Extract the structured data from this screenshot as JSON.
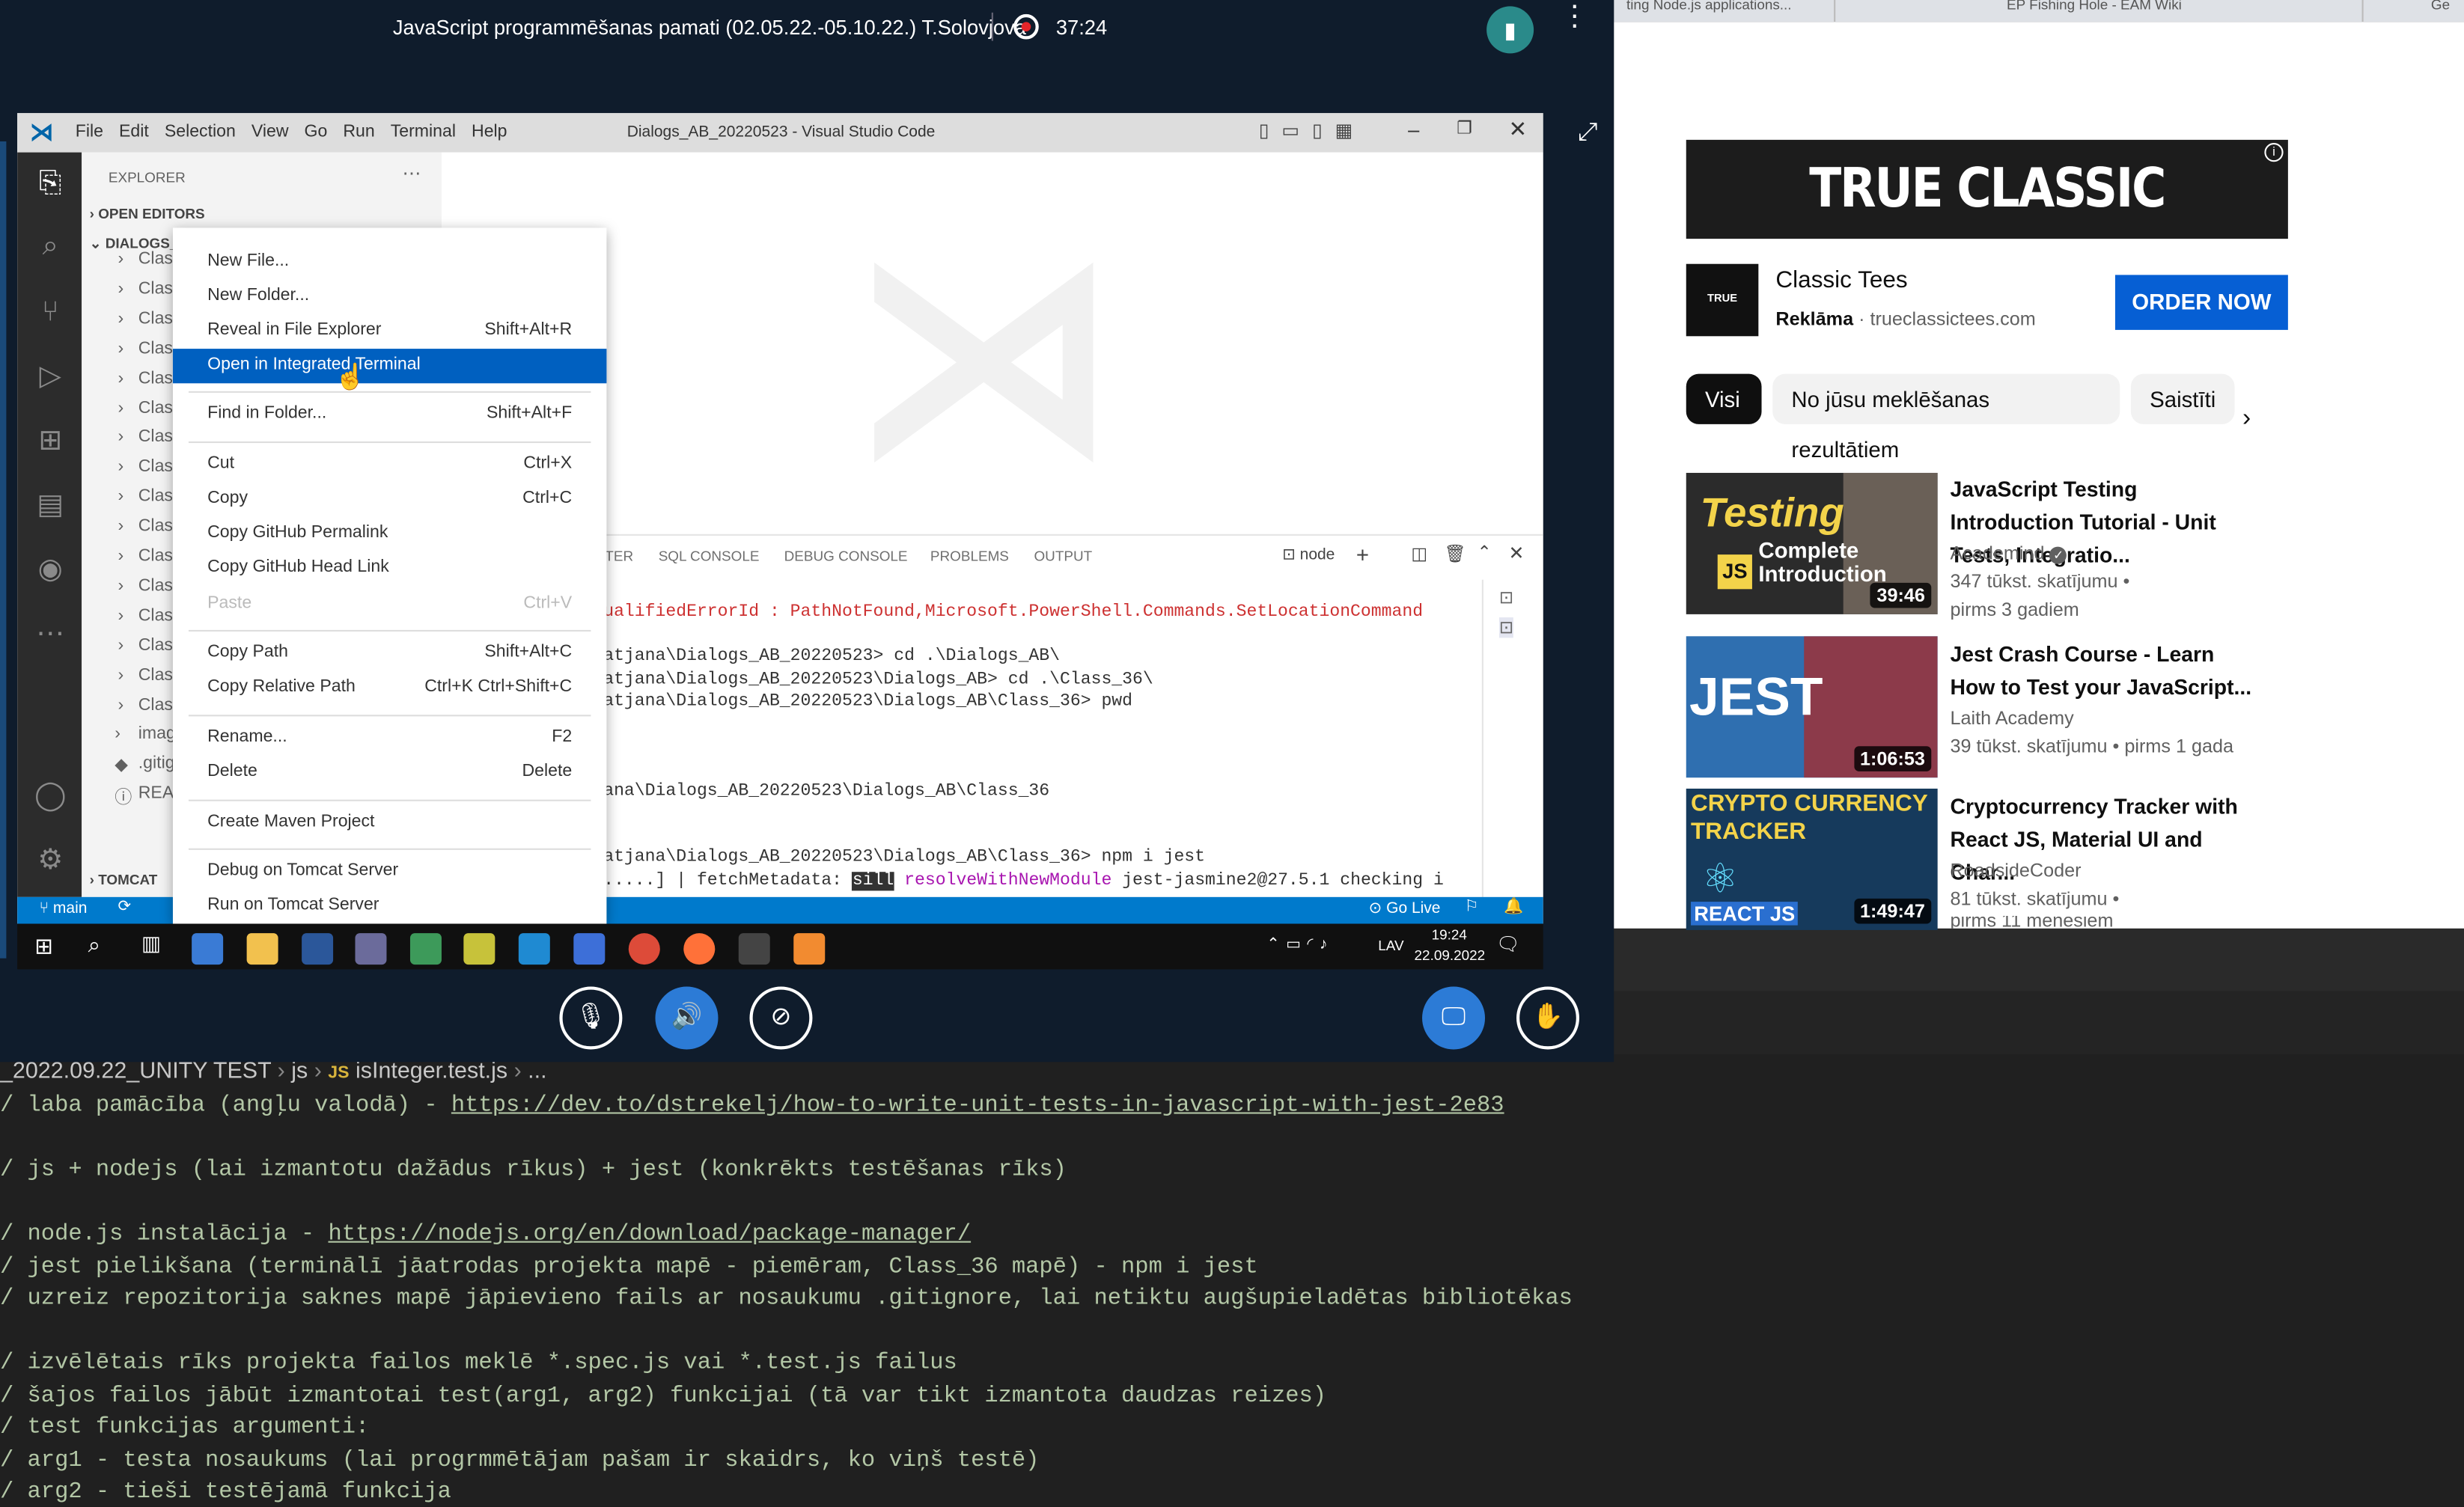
{
  "meeting": {
    "title": "JavaScript programmēšanas pamati (02.05.22.-05.10.22.) T.Solovjova",
    "rec_time": "37:24"
  },
  "vscode": {
    "menu": [
      "File",
      "Edit",
      "Selection",
      "View",
      "Go",
      "Run",
      "Terminal",
      "Help"
    ],
    "window_title": "Dialogs_AB_20220523 - Visual Studio Code",
    "explorer_header": "EXPLORER",
    "open_editors": "OPEN EDITORS",
    "dialogs_folder": "DIALOGS_AB_20220523",
    "tree_items": [
      "Class",
      "Class",
      "Class",
      "Class",
      "Class",
      "Class",
      "Class",
      "Class",
      "Class",
      "Class",
      "Class",
      "Class",
      "Class",
      "Class",
      "Class",
      "Class"
    ],
    "imag": "imag",
    "gitig": ".gitig",
    "readme": "READ",
    "tomcat": "TOMCAT",
    "panel_tabs": [
      "TER",
      "SQL CONSOLE",
      "DEBUG CONSOLE",
      "PROBLEMS",
      "OUTPUT"
    ],
    "terminal_name": "node",
    "terminal_lines": [
      "ualifiedErrorId : PathNotFound,Microsoft.PowerShell.Commands.SetLocationCommand",
      "",
      "atjana\\Dialogs_AB_20220523> cd .\\Dialogs_AB\\",
      "atjana\\Dialogs_AB_20220523\\Dialogs_AB> cd .\\Class_36\\",
      "atjana\\Dialogs_AB_20220523\\Dialogs_AB\\Class_36> pwd",
      "",
      "",
      "",
      "ana\\Dialogs_AB_20220523\\Dialogs_AB\\Class_36",
      "",
      "",
      "atjana\\Dialogs_AB_20220523\\Dialogs_AB\\Class_36> npm i jest"
    ],
    "last_line_a": ".....] | fetchMetadata: ",
    "last_line_sill": "sill",
    "last_line_b": " resolveWithNewModule",
    "last_line_c": " jest-jasmine2@27.5.1 checking i",
    "status_branch": "main",
    "status_golive": "Go Live",
    "context_menu": [
      {
        "label": "New File...",
        "key": ""
      },
      {
        "label": "New Folder...",
        "key": ""
      },
      {
        "label": "Reveal in File Explorer",
        "key": "Shift+Alt+R"
      },
      {
        "label": "Open in Integrated Terminal",
        "key": ""
      },
      {
        "label": "Find in Folder...",
        "key": "Shift+Alt+F"
      },
      {
        "label": "Cut",
        "key": "Ctrl+X"
      },
      {
        "label": "Copy",
        "key": "Ctrl+C"
      },
      {
        "label": "Copy GitHub Permalink",
        "key": ""
      },
      {
        "label": "Copy GitHub Head Link",
        "key": ""
      },
      {
        "label": "Paste",
        "key": "Ctrl+V"
      },
      {
        "label": "Copy Path",
        "key": "Shift+Alt+C"
      },
      {
        "label": "Copy Relative Path",
        "key": "Ctrl+K Ctrl+Shift+C"
      },
      {
        "label": "Rename...",
        "key": "F2"
      },
      {
        "label": "Delete",
        "key": "Delete"
      },
      {
        "label": "Create Maven Project",
        "key": ""
      },
      {
        "label": "Debug on Tomcat Server",
        "key": ""
      },
      {
        "label": "Run on Tomcat Server",
        "key": ""
      }
    ]
  },
  "taskbar": {
    "lang": "LAV",
    "time": "19:24",
    "date": "22.09.2022"
  },
  "browser_tabs": [
    "ting Node.js applications...",
    "EP Fishing Hole - EAM Wiki",
    "Ge"
  ],
  "youtube": {
    "ad": {
      "banner": "TRUE CLASSIC",
      "logo": "TRUE CLASSIC",
      "title": "Classic Tees",
      "sponsored": "Reklāma",
      "domain": "trueclassictees.com",
      "cta": "ORDER NOW"
    },
    "chips": [
      "Visi",
      "No jūsu meklēšanas rezultātiem",
      "Saistīti"
    ],
    "videos": [
      {
        "title": "JavaScript Testing Introduction Tutorial - Unit Tests, Integratio...",
        "channel": "Academind",
        "views": "347 tūkst. skatījumu",
        "age": "pirms 3 gadiem",
        "duration": "39:46",
        "thumb_text": "Testing",
        "thumb_sub": "Complete Introduction",
        "thumb_badge": "JS"
      },
      {
        "title": "Jest Crash Course - Learn How to Test your JavaScript...",
        "channel": "Laith Academy",
        "views": "39 tūkst. skatījumu",
        "age": "pirms 1 gada",
        "duration": "1:06:53",
        "thumb_text": "JEST"
      },
      {
        "title": "Cryptocurrency Tracker with React JS, Material UI and Char...",
        "channel": "RoadsideCoder",
        "views": "81 tūkst. skatījumu",
        "age": "pirms 11 mēnešiem",
        "duration": "1:49:47",
        "thumb_text": "CRYPTO CURRENCY TRACKER",
        "thumb_sub": "REACT JS"
      }
    ]
  },
  "editor": {
    "breadcrumb_path": "_2022.09.22_UNITY TEST",
    "breadcrumb_js": "js",
    "breadcrumb_file": "isInteger.test.js",
    "breadcrumb_more": "...",
    "lines": [
      {
        "t": "/ laba pamācība (angļu valodā) - ",
        "link": "https://dev.to/dstrekelj/how-to-write-unit-tests-in-javascript-with-jest-2e83"
      },
      {
        "t": ""
      },
      {
        "t": "/ js + nodejs (lai izmantotu dažādus rīkus) + jest (konkrēkts testēšanas rīks)"
      },
      {
        "t": ""
      },
      {
        "t": "/ node.js instalācija - ",
        "link": "https://nodejs.org/en/download/package-manager/"
      },
      {
        "t": "/ jest pielikšana (terminālī jāatrodas projekta mapē - piemēram, Class_36 mapē) - npm i jest"
      },
      {
        "t": "/ uzreiz repozitorija saknes mapē jāpievieno fails ar nosaukumu .gitignore, lai netiktu augšupieladētas bibliotēkas"
      },
      {
        "t": ""
      },
      {
        "t": "/ izvēlētais rīks projekta failos meklē *.spec.js vai *.test.js failus"
      },
      {
        "t": "/ šajos failos jābūt izmantotai test(arg1, arg2) funkcijai (tā var tikt izmantota daudzas reizes)"
      },
      {
        "t": "/ test funkcijas argumenti:"
      },
      {
        "t": "/ arg1 - testa nosaukums (lai progrmmētājam pašam ir skaidrs, ko viņš testē)"
      },
      {
        "t": "/ arg2 - tieši testējamā funkcija"
      }
    ]
  }
}
